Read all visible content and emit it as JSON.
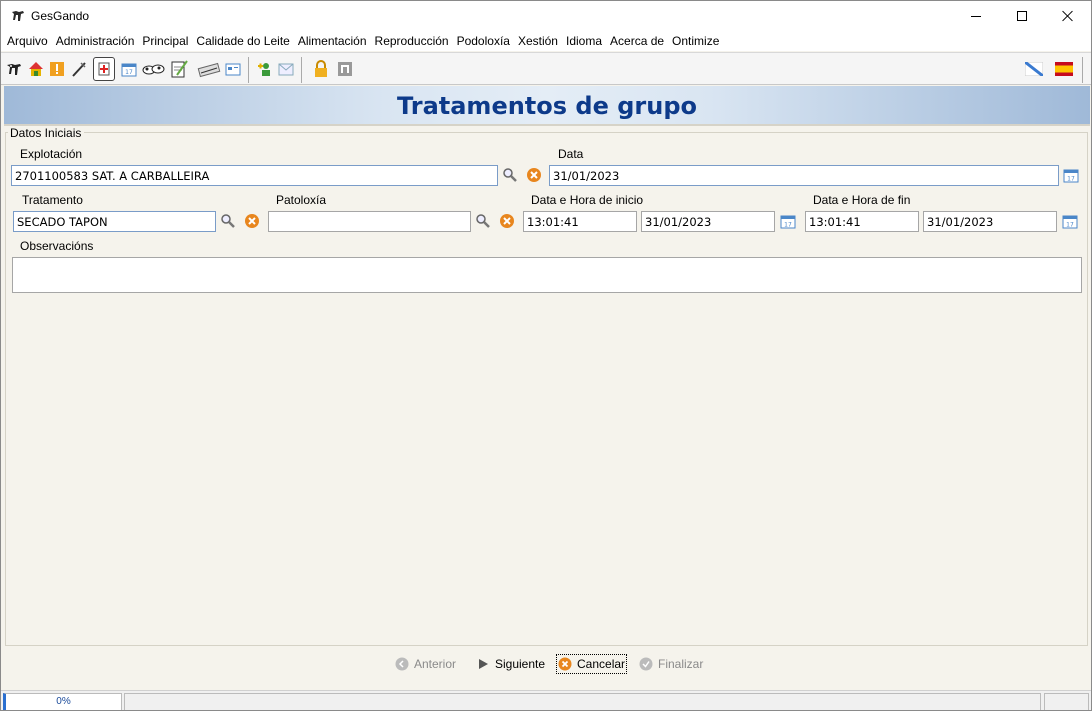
{
  "window": {
    "title": "GesGando"
  },
  "menu": [
    "Arquivo",
    "Administración",
    "Principal",
    "Calidade do Leite",
    "Alimentación",
    "Reproducción",
    "Podoloxía",
    "Xestión",
    "Idioma",
    "Acerca de",
    "Ontimize"
  ],
  "toolbar": {
    "icons": [
      "cow-icon",
      "home-icon",
      "alert-icon",
      "syringe-icon",
      "medical-card-icon",
      "calendar-icon",
      "herd-icon",
      "notepad-icon",
      "pen-icon",
      "window-icon",
      "user-add-icon",
      "mail-icon",
      "lock-icon",
      "terminal-icon"
    ],
    "flags": [
      "galician-flag-icon",
      "spanish-flag-icon"
    ]
  },
  "page": {
    "title": "Tratamentos de grupo"
  },
  "form": {
    "section_label": "Datos Iniciais",
    "explotacion_label": "Explotación",
    "explotacion_value": "2701100583 SAT. A CARBALLEIRA",
    "data_label": "Data",
    "data_value": "31/01/2023",
    "tratamento_label": "Tratamento",
    "tratamento_value": "SECADO TAPON",
    "patoloxia_label": "Patoloxía",
    "patoloxia_value": "",
    "inicio_label": "Data e Hora de inicio",
    "inicio_hora": "13:01:41",
    "inicio_data": "31/01/2023",
    "fin_label": "Data e Hora de fin",
    "fin_hora": "13:01:41",
    "fin_data": "31/01/2023",
    "observacions_label": "Observacións",
    "observacions_value": ""
  },
  "nav": {
    "anterior": "Anterior",
    "siguiente": "Siguiente",
    "cancelar": "Cancelar",
    "finalizar": "Finalizar"
  },
  "status": {
    "progress_text": "0%",
    "progress": 0
  },
  "colors": {
    "title_blue": "#0d3a8a",
    "field_border": "#7a9cc8",
    "clear_orange": "#e8861e"
  }
}
